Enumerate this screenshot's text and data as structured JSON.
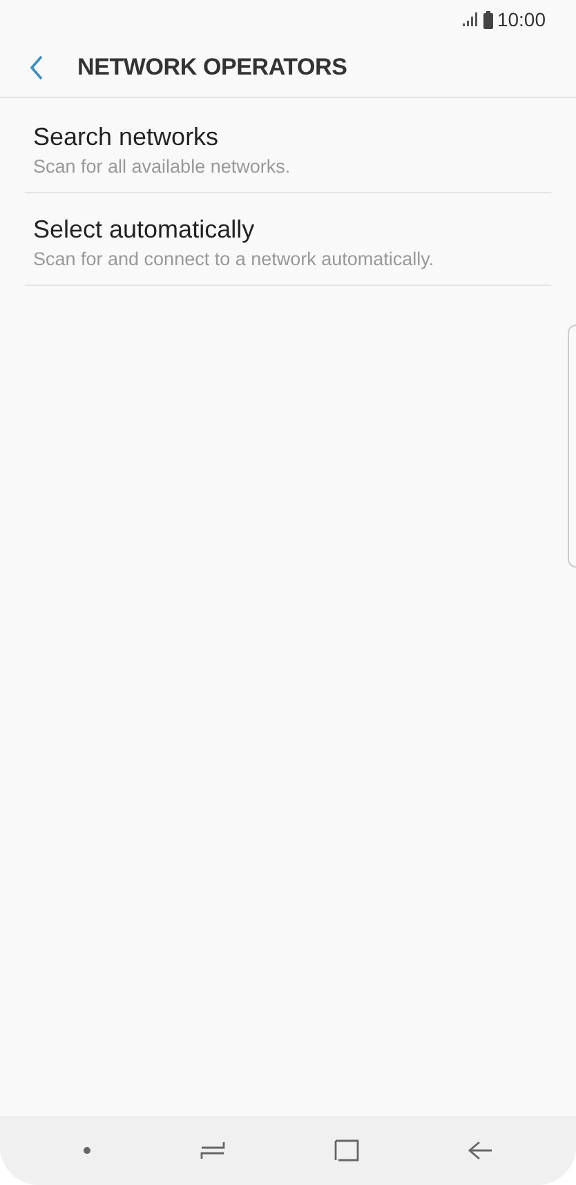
{
  "status_bar": {
    "time": "10:00"
  },
  "header": {
    "title": "NETWORK OPERATORS"
  },
  "items": [
    {
      "title": "Search networks",
      "subtitle": "Scan for all available networks."
    },
    {
      "title": "Select automatically",
      "subtitle": "Scan for and connect to a network automatically."
    }
  ]
}
